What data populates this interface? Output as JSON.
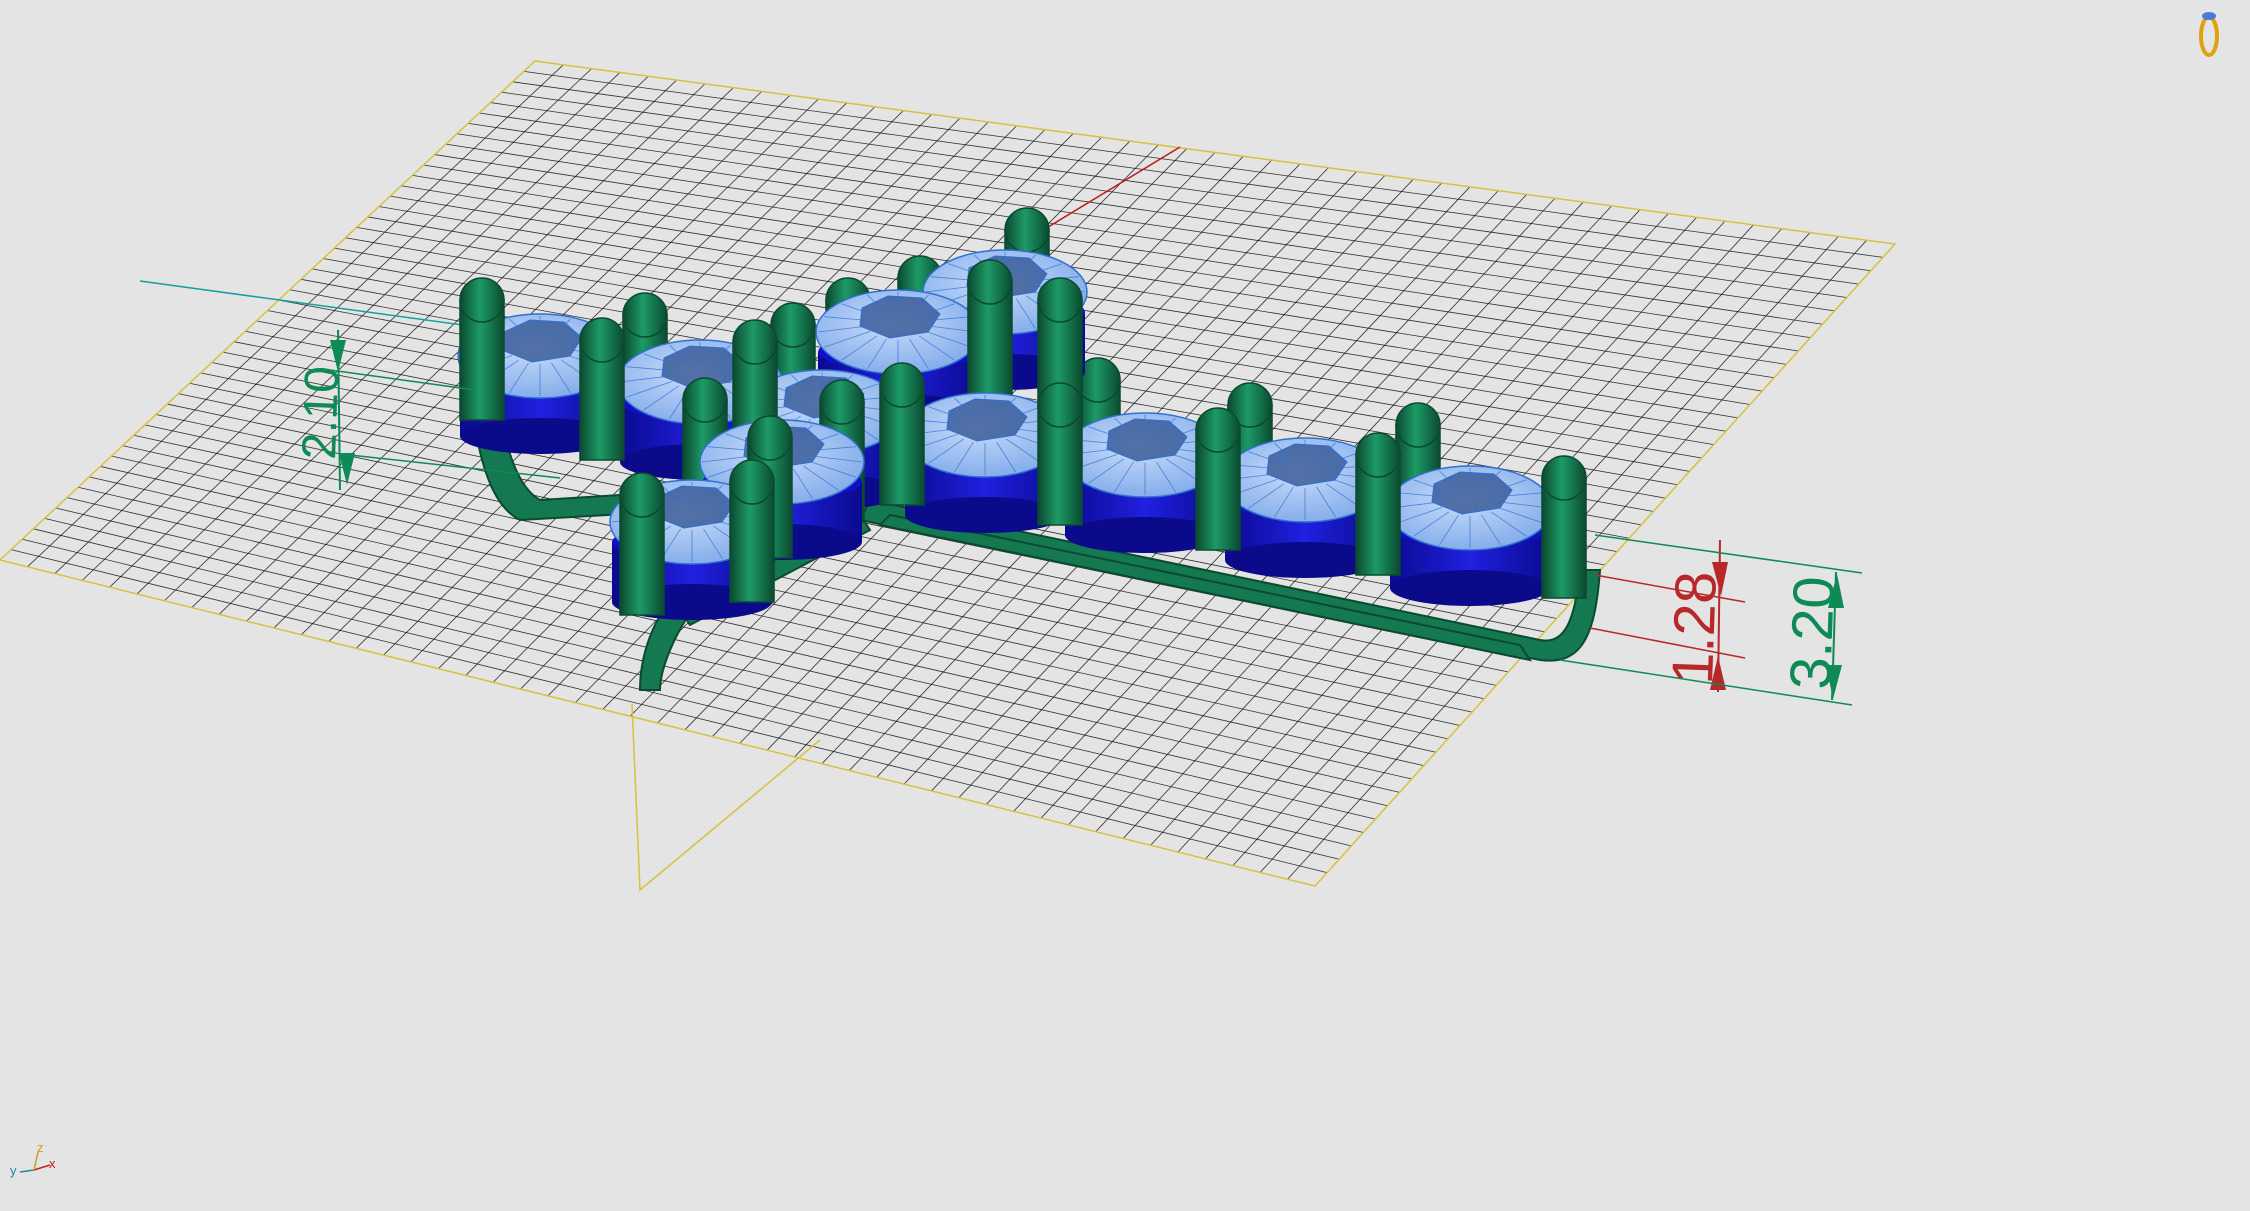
{
  "viewport": {
    "background": "#e4e4e4",
    "grid_color": "#111111",
    "grid_border_color": "#d8c040",
    "x_axis_color": "#c01818",
    "y_axis_color": "#14a0a0",
    "metal_color": "#147850",
    "metal_dark": "#0b4a30",
    "stone_color": "#9cc4f4",
    "stone_edge": "#3070d0",
    "setting_color": "#1010c8"
  },
  "dimensions": {
    "top_prong_gap": {
      "value": "2.10",
      "color": "#0d8a55"
    },
    "bottom_gap": {
      "value": "1.28",
      "color": "#b82828"
    },
    "total_height": {
      "value": "3.20",
      "color": "#0d8a55"
    }
  },
  "axis_indicator": {
    "x_label": "x",
    "y_label": "y",
    "z_label": "z",
    "x_color": "#c02020",
    "y_color": "#1a8aa8",
    "z_color": "#c8a020"
  },
  "corner_icon": {
    "name": "ring-with-gem-icon",
    "metal_color": "#e0a010",
    "gem_color": "#4a7ad8"
  }
}
